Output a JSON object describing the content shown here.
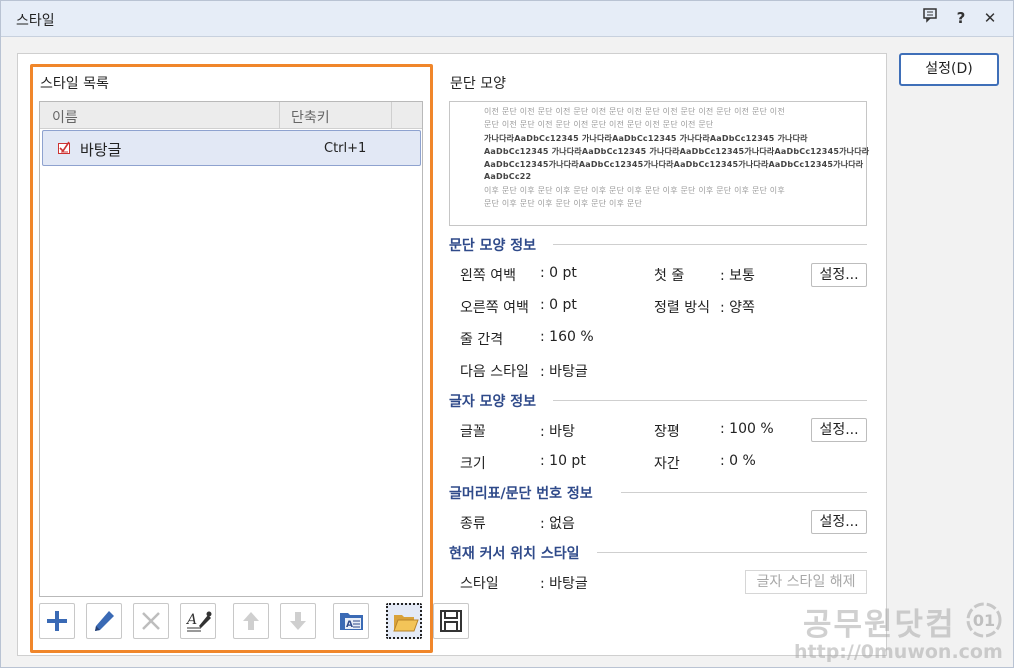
{
  "window": {
    "title": "스타일",
    "icons": [
      "comment-icon",
      "help-icon",
      "close-icon"
    ],
    "help_glyph": "?",
    "close_glyph": "✕"
  },
  "style_list": {
    "title": "스타일 목록",
    "col_name": "이름",
    "col_shortcut": "단축키",
    "rows": [
      {
        "name": "바탕글",
        "shortcut": "Ctrl+1",
        "selected": true
      }
    ]
  },
  "toolbar": [
    {
      "name": "add-style-button",
      "icon": "plus-icon",
      "enabled": true
    },
    {
      "name": "edit-style-button",
      "icon": "pencil-icon",
      "enabled": true
    },
    {
      "name": "delete-style-button",
      "icon": "x-icon",
      "enabled": false
    },
    {
      "name": "apply-format-button",
      "icon": "eyedropper-icon",
      "enabled": true
    },
    {
      "name": "move-up-button",
      "icon": "arrow-up-icon",
      "enabled": false
    },
    {
      "name": "move-down-button",
      "icon": "arrow-down-icon",
      "enabled": false
    },
    {
      "name": "import-style-button",
      "icon": "folder-style-icon",
      "enabled": true
    },
    {
      "name": "open-style-button",
      "icon": "open-folder-icon",
      "enabled": true,
      "selected": true
    },
    {
      "name": "save-style-button",
      "icon": "save-icon",
      "enabled": true
    }
  ],
  "preview": {
    "title": "문단 모양",
    "prev_lines": [
      "이전 문단 이전 문단 이전 문단 이전 문단 이전 문단 이전 문단 이전 문단 이전 문단 이전",
      "문단 이전 문단 이전 문단 이전 문단 이전 문단 이전 문단 이전 문단"
    ],
    "sample_lines": [
      "가나다라AaDbCc12345        가나다라AaDbCc12345        가나다라AaDbCc12345        가나다라",
      "AaDbCc12345  가나다라AaDbCc12345  가나다라AaDbCc12345가나다라AaDbCc12345가나다라",
      "AaDbCc12345가나다라AaDbCc12345가나다라AaDbCc12345가나다라AaDbCc12345가나다라",
      "AaDbCc22"
    ],
    "next_lines": [
      "이후 문단 이후 문단 이후 문단 이후 문단 이후 문단 이후 문단 이후 문단 이후 문단 이후",
      "문단 이후 문단 이후 문단 이후 문단 이후 문단"
    ]
  },
  "para_info": {
    "title": "문단 모양 정보",
    "left_margin_label": "왼쪽 여백",
    "left_margin_value": ": 0 pt",
    "right_margin_label": "오른쪽 여백",
    "right_margin_value": ": 0 pt",
    "line_spacing_label": "줄 간격",
    "line_spacing_value": ": 160 %",
    "next_style_label": "다음 스타일",
    "next_style_value": ": 바탕글",
    "first_line_label": "첫 줄",
    "first_line_value": ": 보통",
    "align_label": "정렬 방식",
    "align_value": ": 양쪽",
    "settings_label": "설정..."
  },
  "char_info": {
    "title": "글자 모양 정보",
    "font_label": "글꼴",
    "font_value": ": 바탕",
    "size_label": "크기",
    "size_value": ": 10 pt",
    "ratio_label": "장평",
    "ratio_value": ": 100 %",
    "spacing_label": "자간",
    "spacing_value": ": 0 %",
    "settings_label": "설정..."
  },
  "numbering_info": {
    "title": "글머리표/문단 번호 정보",
    "type_label": "종류",
    "type_value": ": 없음",
    "settings_label": "설정..."
  },
  "cursor_info": {
    "title": "현재 커서 위치 스타일",
    "style_label": "스타일",
    "style_value": ": 바탕글",
    "unset_label": "글자 스타일 해제"
  },
  "settings_button": "설정(D)",
  "watermark": {
    "brand": "공무원닷컴",
    "url": "http://0muwon.com",
    "logo_text": "01"
  },
  "colors": {
    "accent": "#f0862a",
    "section_title": "#2f4a8a",
    "selection": "#e2e8f5",
    "primary_border": "#3f6fb8"
  }
}
